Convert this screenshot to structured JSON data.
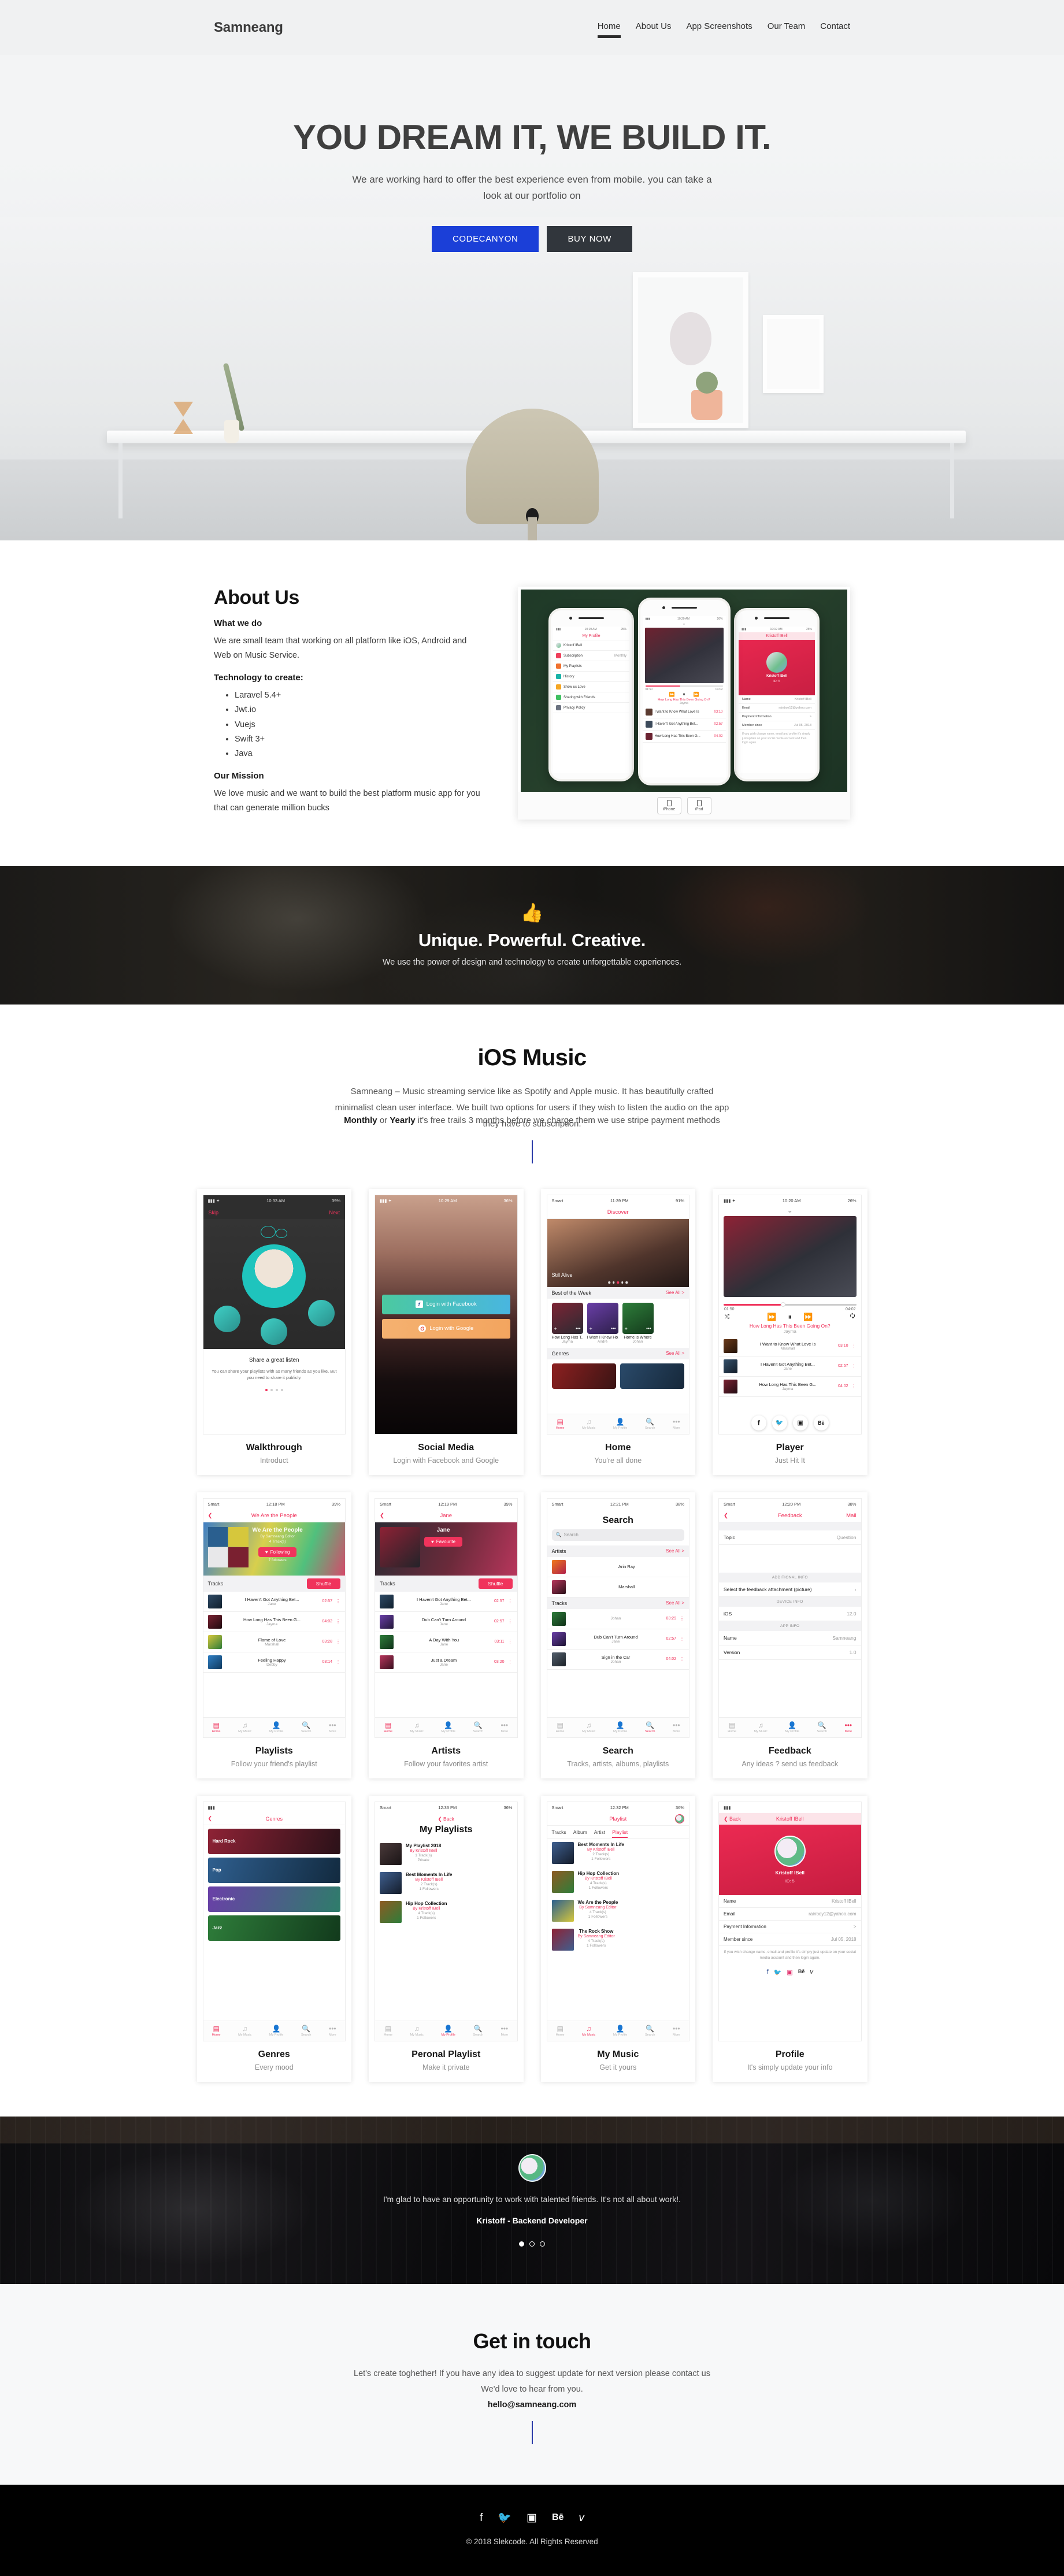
{
  "nav": {
    "brand": "Samneang",
    "links": [
      {
        "label": "Home",
        "active": true
      },
      {
        "label": "About Us",
        "active": false
      },
      {
        "label": "App Screenshots",
        "active": false
      },
      {
        "label": "Our Team",
        "active": false
      },
      {
        "label": "Contact",
        "active": false
      }
    ]
  },
  "hero": {
    "title": "YOU DREAM IT, WE BUILD IT.",
    "subtitle": "We are working hard to offer the best experience even from mobile. you can take a look at our portfolio on",
    "primary_button": "CODECANYON",
    "secondary_button": "BUY NOW",
    "primary_color": "#1b3fd8",
    "secondary_color": "#31363c"
  },
  "about": {
    "heading": "About Us",
    "what_we_do_title": "What we do",
    "what_we_do_text": "We are small team that working on all platform like iOS, Android and Web on Music Service.",
    "technology_title": "Technology to create:",
    "technology": [
      "Laravel 5.4+",
      "Jwt.io",
      "Vuejs",
      "Swift 3+",
      "Java"
    ],
    "mission_title": "Our Mission",
    "mission_text": "We love music and we want to build the best platform music app for you that can generate million bucks",
    "preview": {
      "device_buttons": [
        "iPhone",
        "iPad"
      ],
      "phone_left": {
        "time": "10:19 AM",
        "battery": "25%",
        "title": "My Profile",
        "user": "Kristoff IBell",
        "rows": [
          {
            "label": "Subscription",
            "value": "Monthly",
            "color": "#ef3f5b"
          },
          {
            "label": "My Playlists",
            "value": "",
            "color": "#f0712e"
          },
          {
            "label": "History",
            "value": "",
            "color": "#18b3a7"
          },
          {
            "label": "Show us Love",
            "value": "",
            "color": "#f5a623"
          },
          {
            "label": "Sharing with Friends",
            "value": "",
            "color": "#3fc060"
          },
          {
            "label": "Privacy Policy",
            "value": "",
            "color": "#6b7280"
          }
        ]
      },
      "phone_center": {
        "time": "10:20 AM",
        "battery": "26%",
        "elapsed": "01:50",
        "duration": "04:02",
        "now_playing": "How Long Has This Been Going On?",
        "artist": "Jayma",
        "tracks": [
          {
            "title": "I Want to Know What Love Is",
            "artist": "Marshall",
            "time": "03:10"
          },
          {
            "title": "I Haven't Got Anything Bet...",
            "artist": "Jane",
            "time": "02:57"
          },
          {
            "title": "How Long Has This Been G...",
            "artist": "Jayma",
            "time": "04:02"
          }
        ]
      },
      "phone_right": {
        "time": "10:19 AM",
        "battery": "25%",
        "back": "Back",
        "title": "Kristoff IBell",
        "user": "Kristoff IBell",
        "id": "ID: 5",
        "rows": [
          {
            "label": "Name",
            "value": "Kristoff IBell"
          },
          {
            "label": "Email",
            "value": "rainboy12@yahoo.com"
          },
          {
            "label": "Payment Information",
            "value": ">"
          },
          {
            "label": "Member since",
            "value": "Jul 05, 2018"
          }
        ],
        "note": "If you wish change name, email and profile it's simply just update on your social media account and then login again."
      }
    }
  },
  "banner": {
    "icon": "thumbs-up-icon",
    "heading": "Unique. Powerful. Creative.",
    "text": "We use the power of design and technology to create unforgettable experiences."
  },
  "apps": {
    "heading": "iOS Music",
    "description_1": "Samneang – Music streaming service like as Spotify and Apple music. It has beautifully crafted minimalist clean user interface. We built two options for users if they wish to listen the audio on the app they have to subscription.",
    "description_2_prefix": "Monthly",
    "description_2_mid": " or ",
    "description_2_bold2": "Yearly",
    "description_2_rest": " it's free trails 3 months before we charge them we use stripe payment methods",
    "cards": [
      {
        "title": "Walkthrough",
        "subtitle": "Introduct",
        "screen": {
          "time": "10:33 AM",
          "battery": "39%",
          "skip": "Skip",
          "next": "Next",
          "caption_title": "Share a great listen",
          "caption_text": "You can share your playlists with as many friends as you like. But you need to share it publicly."
        }
      },
      {
        "title": "Social Media",
        "subtitle": "Login with Facebook and Google",
        "screen": {
          "time": "10:29 AM",
          "battery": "36%",
          "facebook_button": "Login with Facebook",
          "google_button": "Login with Google"
        }
      },
      {
        "title": "Home",
        "subtitle": "You're all done",
        "screen": {
          "carrier": "Smart",
          "time": "11:39 PM",
          "battery": "91%",
          "nav_title": "Discover",
          "hero_label": "Still Alive",
          "section1": "Best of the Week",
          "see_all": "See All >",
          "tiles": [
            {
              "title": "How Long Has T...",
              "artist": "Jayma"
            },
            {
              "title": "I Wish I Knew Ho...",
              "artist": "André"
            },
            {
              "title": "Home is Where",
              "artist": "Johan"
            }
          ],
          "section2": "Genres",
          "tabs": [
            "Home",
            "My Music",
            "My Profile",
            "Search",
            "More"
          ]
        }
      },
      {
        "title": "Player",
        "subtitle": "Just Hit It",
        "screen": {
          "time": "10:20 AM",
          "battery": "26%",
          "elapsed": "01:50",
          "duration": "04:02",
          "now_playing": "How Long Has This Been Going On?",
          "artist": "Jayma",
          "tracks": [
            {
              "title": "I Want to Know What Love Is",
              "artist": "Marshall",
              "time": "03:10"
            },
            {
              "title": "I Haven't Got Anything Bet...",
              "artist": "Jane",
              "time": "02:57"
            },
            {
              "title": "How Long Has This Been G...",
              "artist": "Jayma",
              "time": "04:02"
            }
          ],
          "share_icons": [
            "facebook-icon",
            "twitter-icon",
            "instagram-icon",
            "behance-icon"
          ]
        }
      },
      {
        "title": "Playlists",
        "subtitle": "Follow your friend's playlist",
        "screen": {
          "carrier": "Smart",
          "time": "12:18 PM",
          "battery": "39%",
          "nav_title": "We Are the People",
          "playlist_name": "We Are the People",
          "playlist_by": "By Samneang Editor",
          "playlist_count": "4 Track(s)",
          "follow_button": "Following",
          "followers": "7 followers",
          "tracks_label": "Tracks",
          "shuffle_button": "Shuffle",
          "tracks": [
            {
              "title": "I Haven't Got Anything Bet...",
              "artist": "Jane",
              "time": "02:57"
            },
            {
              "title": "How Long Has This Been G...",
              "artist": "Jayma",
              "time": "04:02"
            },
            {
              "title": "Flame of Love",
              "artist": "Marshall",
              "time": "03:28"
            },
            {
              "title": "Feeling Happy",
              "artist": "Debby",
              "time": "03:14"
            }
          ]
        }
      },
      {
        "title": "Artists",
        "subtitle": "Follow your favorites artist",
        "screen": {
          "carrier": "Smart",
          "time": "12:19 PM",
          "battery": "39%",
          "nav_title": "Jane",
          "artist_name": "Jane",
          "follow_button": "Favourite",
          "tracks_label": "Tracks",
          "shuffle_button": "Shuffle",
          "tracks": [
            {
              "title": "I Haven't Got Anything Bet...",
              "artist": "Jane",
              "time": "02:57"
            },
            {
              "title": "Dub Can't Turn Around",
              "artist": "Jane",
              "time": "02:57"
            },
            {
              "title": "A Day With You",
              "artist": "Jane",
              "time": "03:11"
            },
            {
              "title": "Just a Dream",
              "artist": "Jane",
              "time": "03:20"
            }
          ]
        }
      },
      {
        "title": "Search",
        "subtitle": "Tracks, artists, albums, playlists",
        "screen": {
          "carrier": "Smart",
          "time": "12:21 PM",
          "battery": "38%",
          "heading": "Search",
          "placeholder": "Search",
          "artists_label": "Artists",
          "see_all": "See All >",
          "artists": [
            "Arin Ray",
            "Marshall"
          ],
          "tracks_label": "Tracks",
          "tracks": [
            {
              "title": "",
              "artist": "Johan",
              "time": "03:29"
            },
            {
              "title": "Dub Can't Turn Around",
              "artist": "Jane",
              "time": "02:57"
            },
            {
              "title": "Sign in the Car",
              "artist": "Johan",
              "time": "04:02"
            }
          ]
        }
      },
      {
        "title": "Feedback",
        "subtitle": "Any ideas ? send us feedback",
        "screen": {
          "carrier": "Smart",
          "time": "12:20 PM",
          "battery": "38%",
          "nav_title": "Feedback",
          "mail": "Mail",
          "topic_label": "Topic",
          "topic_value": "Question",
          "additional_info": "ADDITIONAL INFO",
          "attachment": "Select the feedback attachment (picture)",
          "device_info": "DEVICE INFO",
          "ios_label": "iOS",
          "ios_value": "12.0",
          "app_info": "APP INFO",
          "name_label": "Name",
          "name_value": "Samneang",
          "version_label": "Version",
          "version_value": "1.0"
        }
      },
      {
        "title": "Genres",
        "subtitle": "Every mood",
        "screen": {
          "nav_title": "Genres",
          "items": [
            "Hard Rock",
            "Pop",
            "Electronic",
            "Jazz"
          ]
        }
      },
      {
        "title": "Peronal Playlist",
        "subtitle": "Make it private",
        "screen": {
          "carrier": "Smart",
          "time": "12:33 PM",
          "battery": "36%",
          "back": "Back",
          "heading": "My Playlists",
          "items": [
            {
              "title": "My Playlist 2018",
              "by": "By Kristoff IBell",
              "count": "1 Track(s)",
              "extra": "Private"
            },
            {
              "title": "Best Moments In Life",
              "by": "By Kristoff IBell",
              "count": "2 Track(s)",
              "extra": "1 Followers"
            },
            {
              "title": "Hip Hop Collection",
              "by": "By Kristoff IBell",
              "count": "4 Track(s)",
              "extra": "1 Followers"
            }
          ]
        }
      },
      {
        "title": "My Music",
        "subtitle": "Get it yours",
        "screen": {
          "carrier": "Smart",
          "time": "12:32 PM",
          "battery": "36%",
          "nav_title": "Playlist",
          "tabs": [
            "Tracks",
            "Album",
            "Artist",
            "Playlist"
          ],
          "active_tab": "Playlist",
          "items": [
            {
              "title": "Best Moments In Life",
              "by": "By Kristoff IBell",
              "count": "2 Track(s)",
              "extra": "1 Followers"
            },
            {
              "title": "Hip Hop Collection",
              "by": "By Kristoff IBell",
              "count": "4 Track(s)",
              "extra": "1 Followers"
            },
            {
              "title": "We Are the People",
              "by": "By Samneang Editor",
              "count": "4 Track(s)",
              "extra": "1 Followers"
            },
            {
              "title": "The Rock Show",
              "by": "By Samneang Editor",
              "count": "4 Track(s)",
              "extra": "1 Followers"
            }
          ]
        }
      },
      {
        "title": "Profile",
        "subtitle": "It's simply update your info",
        "screen": {
          "back": "Back",
          "nav_title": "Kristoff IBell",
          "user": "Kristoff IBell",
          "id": "ID: 5",
          "rows": [
            {
              "label": "Name",
              "value": "Kristoff IBell"
            },
            {
              "label": "Email",
              "value": "rainboy12@yahoo.com"
            },
            {
              "label": "Payment Information",
              "value": ">"
            },
            {
              "label": "Member since",
              "value": "Jul 05, 2018"
            }
          ],
          "note": "If you wish change name, email and profile it's simply just update on your social media account and then login again.",
          "social": [
            "facebook-icon",
            "twitter-icon",
            "instagram-icon",
            "behance-icon",
            "vimeo-icon"
          ]
        }
      }
    ]
  },
  "testimonial": {
    "quote": "I'm glad to have an opportunity to work with talented friends. It's not all about work!.",
    "author": "Kristoff - Backend Developer",
    "dots": 3,
    "active_dot": 1
  },
  "contact": {
    "heading": "Get in touch",
    "text": "Let's create toghether! If you have any idea to suggest update for next version please contact us We'd love to hear from you.",
    "email": "hello@samneang.com"
  },
  "footer": {
    "social": [
      {
        "name": "facebook-icon",
        "glyph": "f"
      },
      {
        "name": "twitter-icon",
        "glyph": "ᵛ"
      },
      {
        "name": "instagram-icon",
        "glyph": "□"
      },
      {
        "name": "behance-icon",
        "glyph": "Bē"
      },
      {
        "name": "vimeo-icon",
        "glyph": "v"
      }
    ],
    "copyright": "© 2018 Slekcode. All Rights Reserved"
  }
}
